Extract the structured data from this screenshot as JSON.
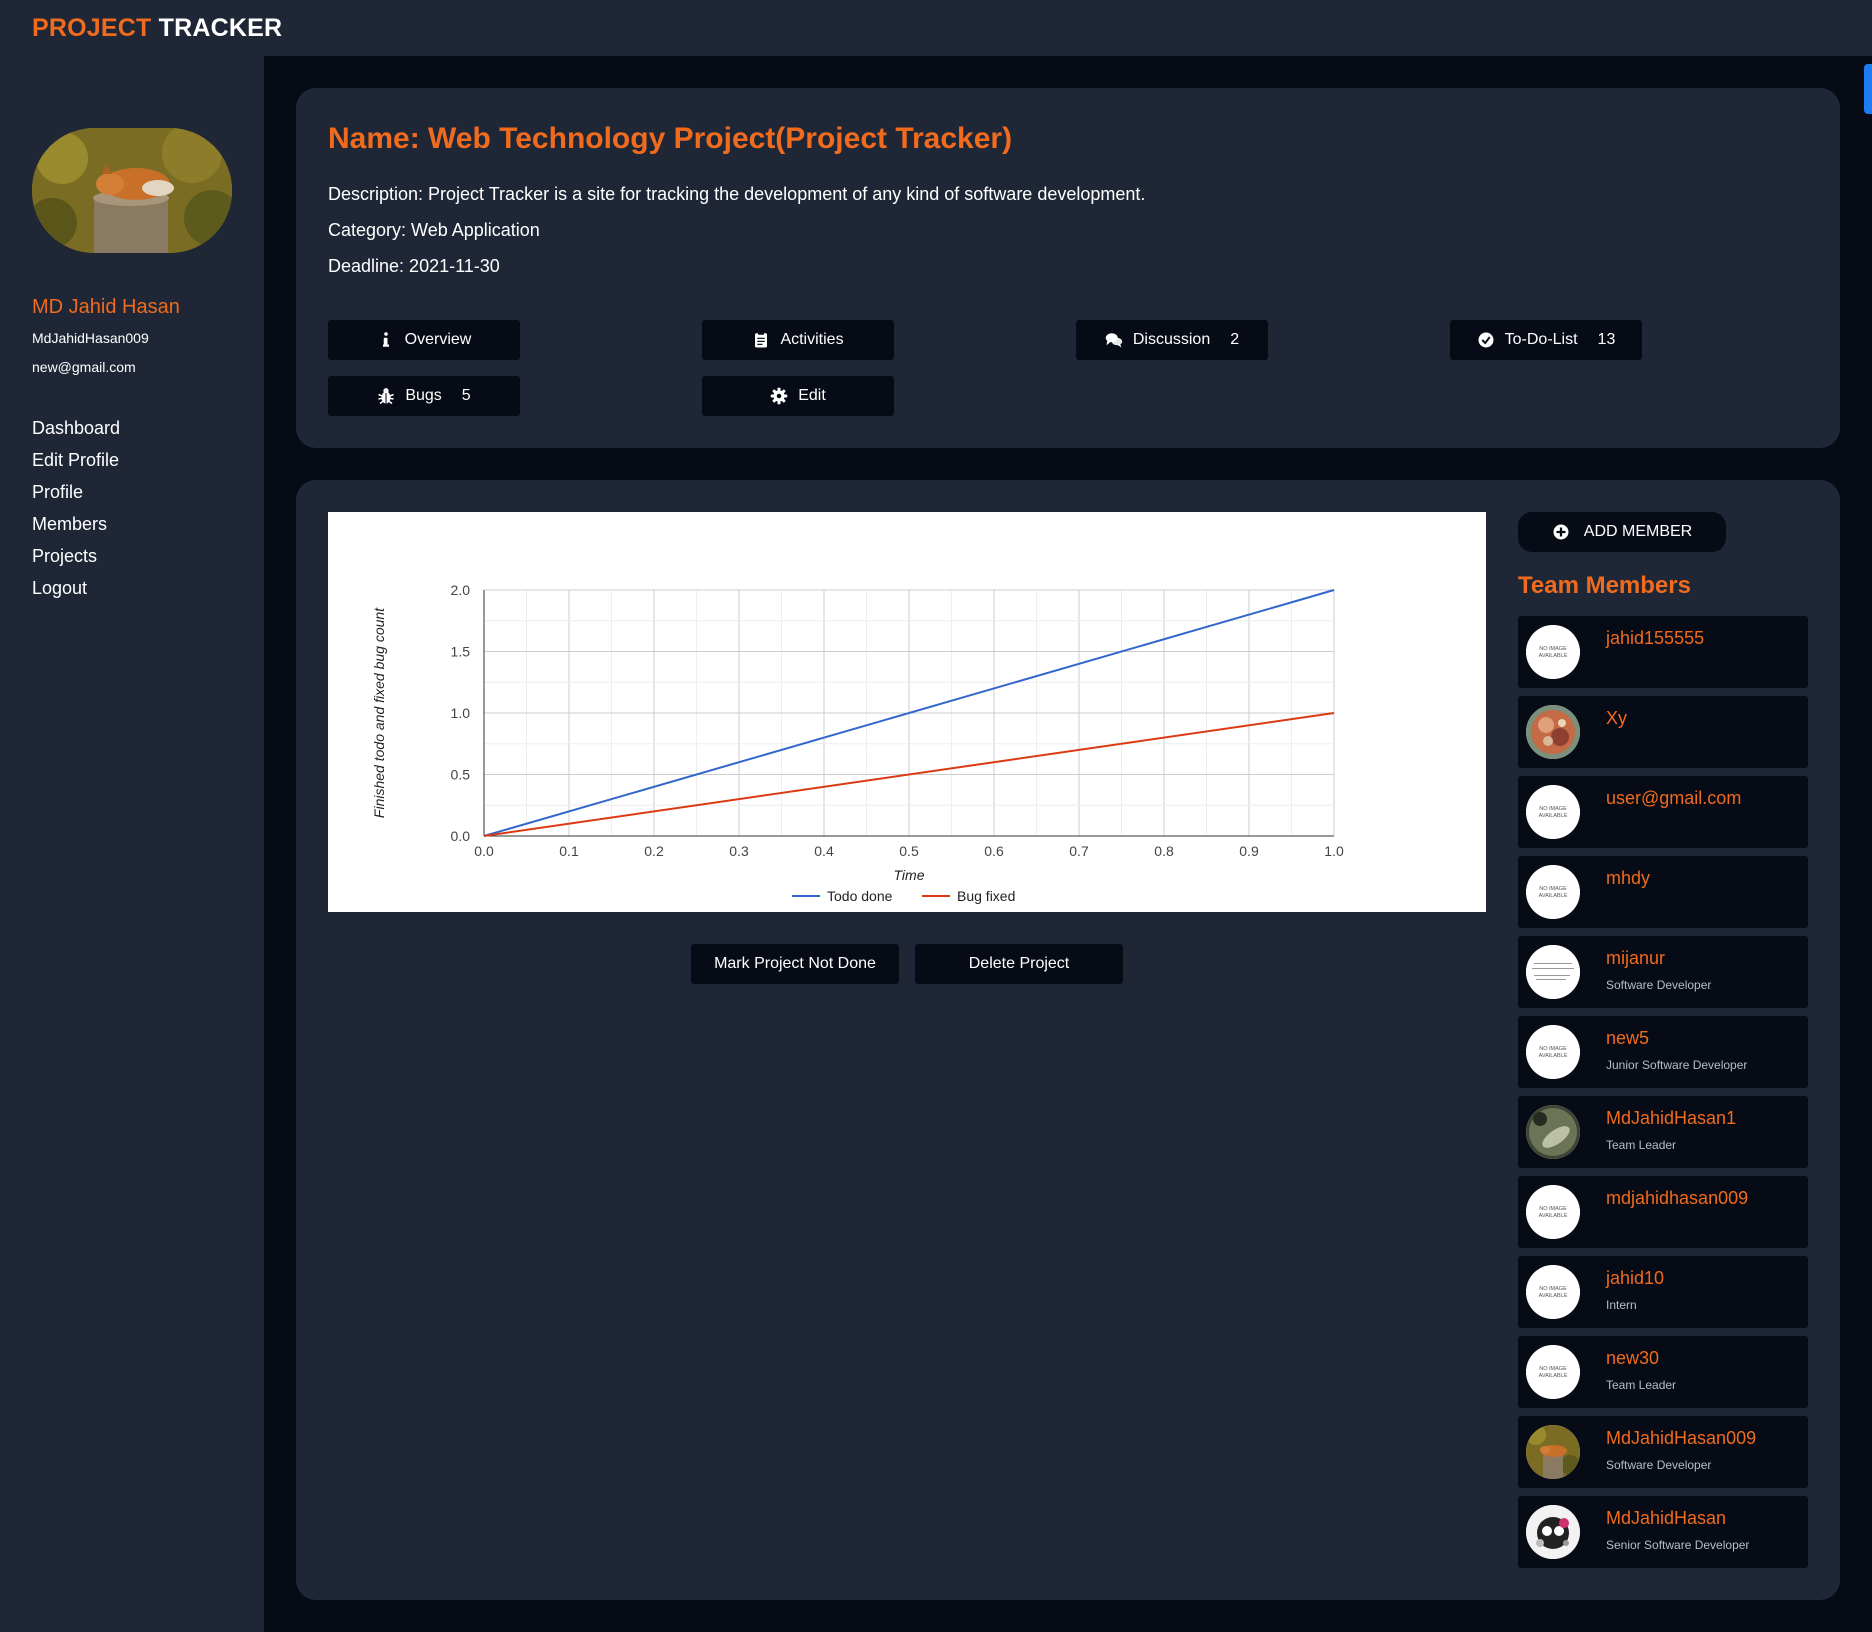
{
  "brand": {
    "part1": "PROJECT",
    "part2": "TRACKER"
  },
  "user": {
    "name": "MD Jahid Hasan",
    "handle": "MdJahidHasan009",
    "email": "new@gmail.com"
  },
  "nav": [
    "Dashboard",
    "Edit Profile",
    "Profile",
    "Members",
    "Projects",
    "Logout"
  ],
  "project": {
    "title": "Name: Web Technology Project(Project Tracker)",
    "description": "Description: Project Tracker is a site for tracking the development of any kind of software development.",
    "category": "Category: Web Application",
    "deadline": "Deadline: 2021-11-30"
  },
  "tabs": [
    {
      "label": "Overview",
      "count": "",
      "icon": "info-icon"
    },
    {
      "label": "Activities",
      "count": "",
      "icon": "clipboard-icon"
    },
    {
      "label": "Discussion",
      "count": "2",
      "icon": "comments-icon"
    },
    {
      "label": "To-Do-List",
      "count": "13",
      "icon": "check-circle-icon"
    },
    {
      "label": "Bugs",
      "count": "5",
      "icon": "bug-icon"
    },
    {
      "label": "Edit",
      "count": "",
      "icon": "gear-icon"
    }
  ],
  "chart_data": {
    "type": "line",
    "x": [
      0.0,
      1.0
    ],
    "series": [
      {
        "name": "Todo done",
        "values": [
          0.0,
          2.0
        ],
        "color": "#3366cc"
      },
      {
        "name": "Bug fixed",
        "values": [
          0.0,
          1.0
        ],
        "color": "#dc3912"
      }
    ],
    "xlabel": "Time",
    "ylabel": "Finished todo and fixed bug count",
    "xlim": [
      0.0,
      1.0
    ],
    "ylim": [
      0.0,
      2.0
    ],
    "xticks": [
      "0.0",
      "0.1",
      "0.2",
      "0.3",
      "0.4",
      "0.5",
      "0.6",
      "0.7",
      "0.8",
      "0.9",
      "1.0"
    ],
    "yticks": [
      "0.0",
      "0.5",
      "1.0",
      "1.5",
      "2.0"
    ],
    "grid": true,
    "legend": "bottom"
  },
  "actions": {
    "mark_not_done": "Mark Project Not Done",
    "delete": "Delete Project"
  },
  "add_member_label": "ADD MEMBER",
  "team_heading": "Team Members",
  "no_image_text": [
    "NO IMAGE",
    "AVAILABLE"
  ],
  "members": [
    {
      "name": "jahid155555",
      "role": "",
      "avatar": "no-image"
    },
    {
      "name": "Xy",
      "role": "",
      "avatar": "photo-orange"
    },
    {
      "name": "user@gmail.com",
      "role": "",
      "avatar": "no-image"
    },
    {
      "name": "mhdy",
      "role": "",
      "avatar": "no-image"
    },
    {
      "name": "mijanur",
      "role": "Software Developer",
      "avatar": "document"
    },
    {
      "name": "new5",
      "role": "Junior Software Developer",
      "avatar": "no-image"
    },
    {
      "name": "MdJahidHasan1",
      "role": "Team Leader",
      "avatar": "photo-green"
    },
    {
      "name": "mdjahidhasan009",
      "role": "",
      "avatar": "no-image"
    },
    {
      "name": "jahid10",
      "role": "Intern",
      "avatar": "no-image"
    },
    {
      "name": "new30",
      "role": "Team Leader",
      "avatar": "no-image"
    },
    {
      "name": "MdJahidHasan009",
      "role": "Software Developer",
      "avatar": "photo-fox"
    },
    {
      "name": "MdJahidHasan",
      "role": "Senior Software Developer",
      "avatar": "photo-skull"
    }
  ],
  "colors": {
    "accent": "#f06b1d",
    "panel": "#1f2736",
    "background": "#060b16",
    "todo_line": "#3366cc",
    "bug_line": "#dc3912"
  }
}
